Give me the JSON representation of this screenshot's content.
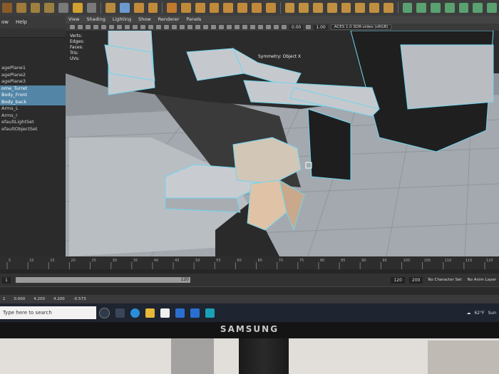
{
  "monitor": {
    "brand": "SAMSUNG"
  },
  "outliner": {
    "menu": [
      "ow",
      "Help"
    ],
    "items": [
      "",
      "",
      "",
      "",
      "agePlane1",
      "agePlane2",
      "agePlane3",
      "ome_Turret",
      "Body_Front",
      "Body_back",
      "Arms_L",
      "Arms_r",
      "efaultLightSet",
      "efaultObjectSet"
    ],
    "selected": [
      7,
      8,
      9
    ]
  },
  "viewport": {
    "menu": [
      "View",
      "Shading",
      "Lighting",
      "Show",
      "Renderer",
      "Panels"
    ],
    "fields": [
      "0.00",
      "1.00"
    ],
    "color_space": "ACES 1.0 SDR-video (sRGB)",
    "hud": [
      {
        "k": "Verts:",
        "a": "",
        "b": ""
      },
      {
        "k": "Edges:",
        "a": "",
        "b": ""
      },
      {
        "k": "Faces:",
        "a": "",
        "b": ""
      },
      {
        "k": "Tris:",
        "a": "",
        "b": ""
      },
      {
        "k": "UVs:",
        "a": "",
        "b": ""
      }
    ],
    "symmetry": "Symmetry: Object X",
    "camera": "persp"
  },
  "timeline": {
    "ticks": [
      "5",
      "10",
      "15",
      "20",
      "25",
      "30",
      "35",
      "40",
      "45",
      "50",
      "55",
      "60",
      "65",
      "70",
      "75",
      "80",
      "85",
      "90",
      "95",
      "100",
      "105",
      "110",
      "115",
      "120"
    ]
  },
  "range": {
    "start": "1",
    "slider_end": "120",
    "end1": "120",
    "end2": "200",
    "character_set": "No Character Set",
    "anim_layer": "No Anim Layer"
  },
  "status": [
    "1",
    "0.000",
    "4.200",
    "4.200",
    "-0.573"
  ],
  "taskbar": {
    "search_placeholder": "Type here to search",
    "tray_temp": "62°F",
    "tray_text": "Sun"
  },
  "colors": {
    "accent": "#5285a6",
    "wire": "#6fd6f0",
    "taskbar": "#1e2430"
  }
}
